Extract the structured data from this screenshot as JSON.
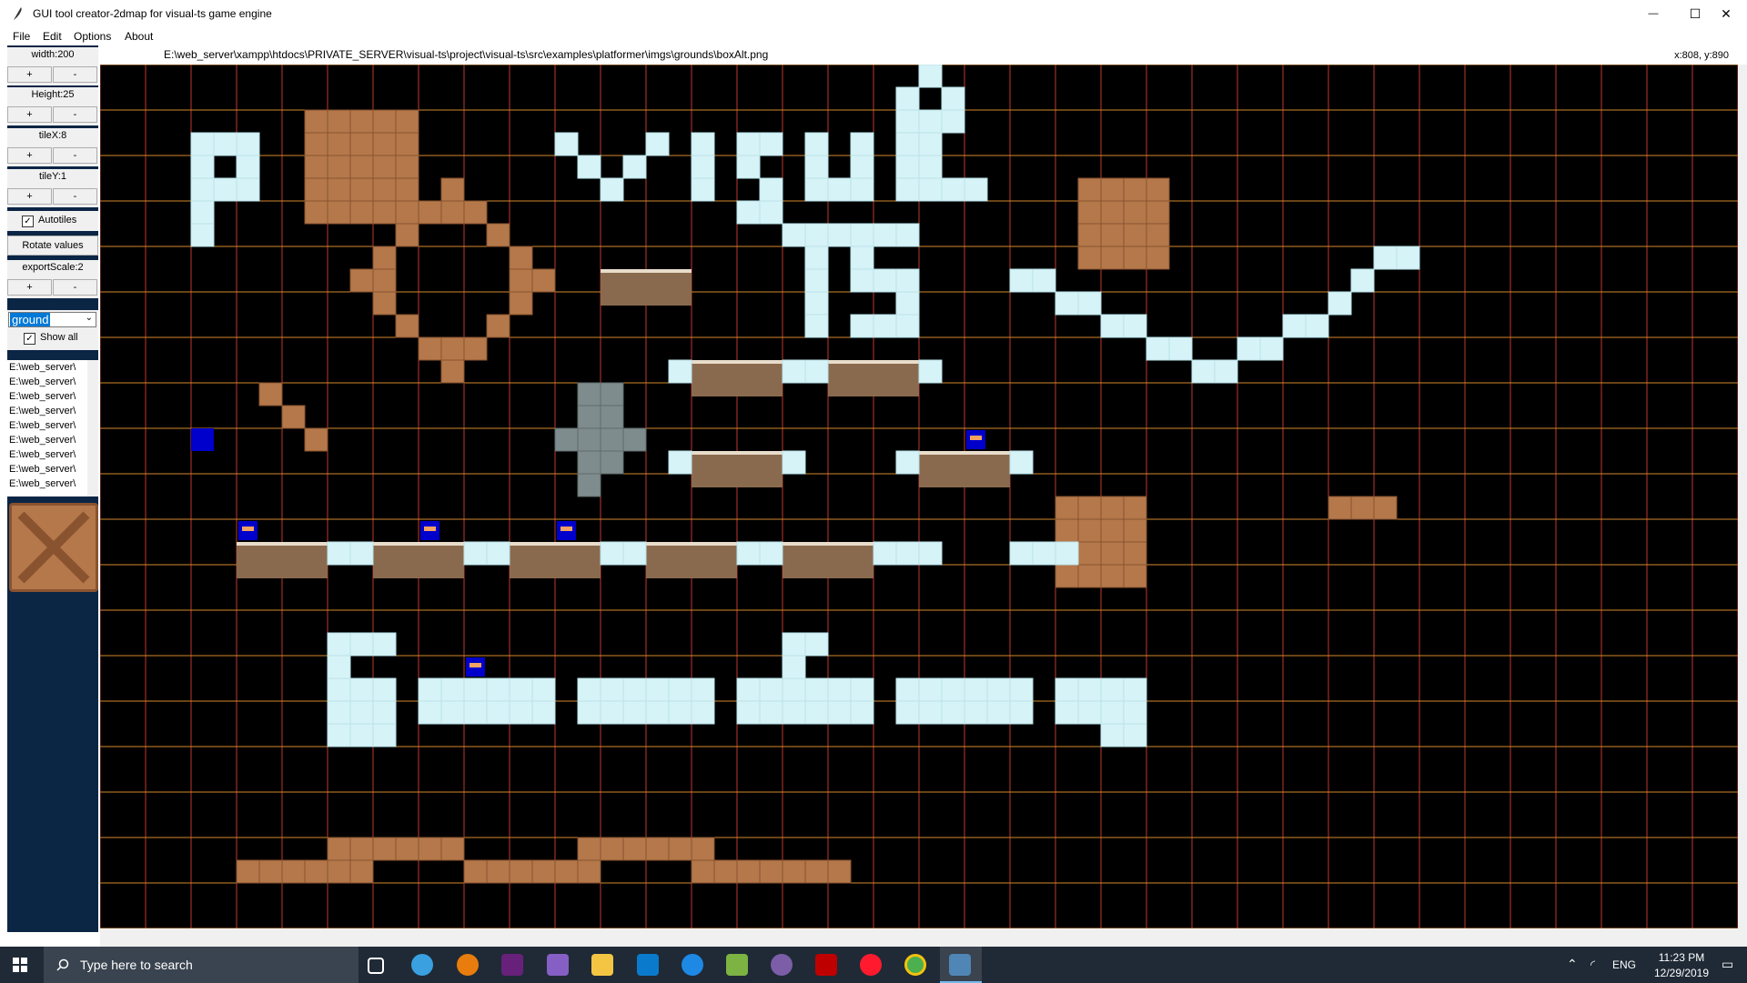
{
  "window": {
    "title": "GUI tool creator-2dmap for visual-ts game engine",
    "minimize_glyph": "—",
    "maximize_glyph": "☐",
    "close_glyph": "✕"
  },
  "menu": {
    "items": [
      "File",
      "Edit",
      "Options",
      "About"
    ]
  },
  "sidebar": {
    "width_label": "width:200",
    "height_label": "Height:25",
    "tilex_label": "tileX:8",
    "tiley_label": "tileY:1",
    "plus": "+",
    "minus": "-",
    "autotiles_label": "Autotiles",
    "autotiles_checked": true,
    "rotate_label": "Rotate values",
    "export_label": "exportScale:2",
    "layer_select_value": "ground",
    "show_all_label": "Show all",
    "show_all_checked": true,
    "file_list": [
      "E:\\web_server\\",
      "E:\\web_server\\",
      "E:\\web_server\\",
      "E:\\web_server\\",
      "E:\\web_server\\",
      "E:\\web_server\\",
      "E:\\web_server\\",
      "E:\\web_server\\",
      "E:\\web_server\\"
    ],
    "preview_tile": "box"
  },
  "pathbar": {
    "path": "E:\\web_server\\xampp\\htdocs\\PRIVATE_SERVER\\visual-ts\\project\\visual-ts\\src\\examples\\platformer\\imgs\\grounds\\boxAlt.png",
    "coords": "x:808, y:890"
  },
  "colors": {
    "canvas_bg": "#000000",
    "grid_vertical": "#c0392b",
    "grid_horizontal": "#d4882b",
    "ice": "#d6f3f7",
    "box": "#b4784a",
    "box_border": "#8a5330",
    "ground": "#8a6a4e",
    "ground_top": "#e8dccb",
    "stone": "#7f8c8d",
    "mushroom_bg": "#0000cc",
    "sidebar_bg": "#0b2545",
    "taskbar_bg": "#1f2a36"
  },
  "taskbar": {
    "search_placeholder": "Type here to search",
    "time": "11:23 PM",
    "date": "12/29/2019",
    "lang": "ENG",
    "apps": [
      "task-view",
      "app-circle",
      "blender",
      "visual-studio-purple",
      "visual-studio",
      "file-explorer",
      "vscode",
      "app-blue",
      "notepad",
      "app-purple",
      "filezilla",
      "opera",
      "chrome",
      "python"
    ]
  }
}
